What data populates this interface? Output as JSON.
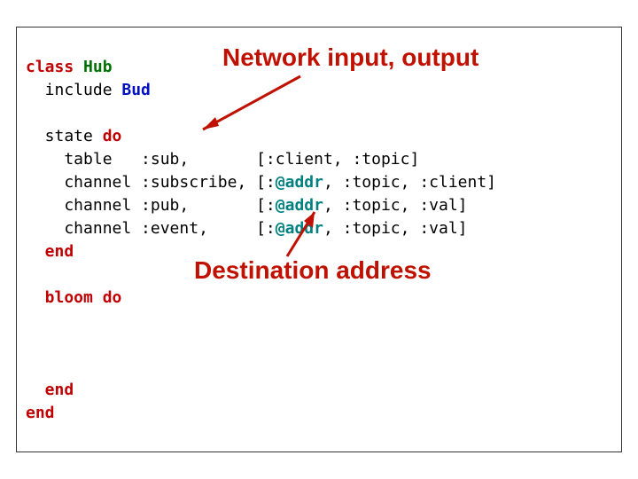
{
  "code": {
    "l1a": "class",
    "l1b": "Hub",
    "l2a": "  include ",
    "l2b": "Bud",
    "l3": "",
    "l4a": "  state ",
    "l4b": "do",
    "l5": "    table   :sub,       [:client, :topic]",
    "l6a": "    channel :subscribe, [:",
    "l6addr": "@addr",
    "l6b": ", :topic, :client]",
    "l7a": "    channel :pub,       [:",
    "l7addr": "@addr",
    "l7b": ", :topic, :val]",
    "l8a": "    channel :event,     [:",
    "l8addr": "@addr",
    "l8b": ", :topic, :val]",
    "l9": "  end",
    "l10": "",
    "l11a": "  bloom ",
    "l11b": "do",
    "l12": "",
    "l13": "",
    "l14": "",
    "l15": "  end",
    "l16": "end"
  },
  "callouts": {
    "net": "Network input, output",
    "dest": "Destination address"
  }
}
